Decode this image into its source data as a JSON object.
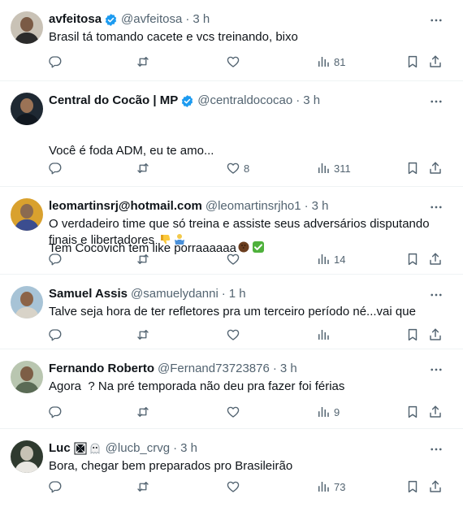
{
  "tweets": [
    {
      "name": "avfeitosa",
      "verified": true,
      "handle": "@avfeitosa",
      "time": "3 h",
      "text": "Brasil tá tomando cacete e vcs treinando, bixo",
      "likes": "",
      "views": "81"
    },
    {
      "name": "Central do Cocão | MP",
      "verified": true,
      "handle": "@centraldococao",
      "time": "3 h",
      "text_line1": "Você é foda ADM, eu te amo...",
      "text_line2": "Tem Cocovich tem like porraaaaaa",
      "emojis": [
        "coconut-emoji",
        "check-mark-emoji"
      ],
      "likes": "8",
      "views": "311"
    },
    {
      "name": "leomartinsrj@hotmail.com",
      "verified": false,
      "handle": "@leomartinsrjho1",
      "time": "3 h",
      "text": "O verdadeiro time que só treina e assiste seus adversários disputando finais e libertadores",
      "emojis": [
        "thumbs-down-emoji",
        "person-shrugging-emoji"
      ],
      "likes": "",
      "views": "14"
    },
    {
      "name": "Samuel Assis",
      "verified": false,
      "handle": "@samuelydanni",
      "time": "1 h",
      "text": "Talve seja hora de ter refletores pra um terceiro período né...vai que",
      "likes": "",
      "views": ""
    },
    {
      "name": "Fernando Roberto",
      "verified": false,
      "handle": "@Fernand73723876",
      "time": "3 h",
      "text": "Agora  ? Na pré temporada não deu pra fazer foi férias",
      "likes": "",
      "views": "9"
    },
    {
      "name": "Luc",
      "verified": false,
      "name_emojis": [
        "maltese-cross-emoji",
        "ghost-emoji"
      ],
      "handle": "@lucb_crvg",
      "time": "3 h",
      "text": "Bora, chegar bem preparados pro Brasileirão",
      "likes": "",
      "views": "73"
    }
  ],
  "dot": "·",
  "colors": {
    "text": "#0f1419",
    "secondary": "#536471",
    "verified": "#1d9bf0",
    "divider": "#eff3f4"
  }
}
